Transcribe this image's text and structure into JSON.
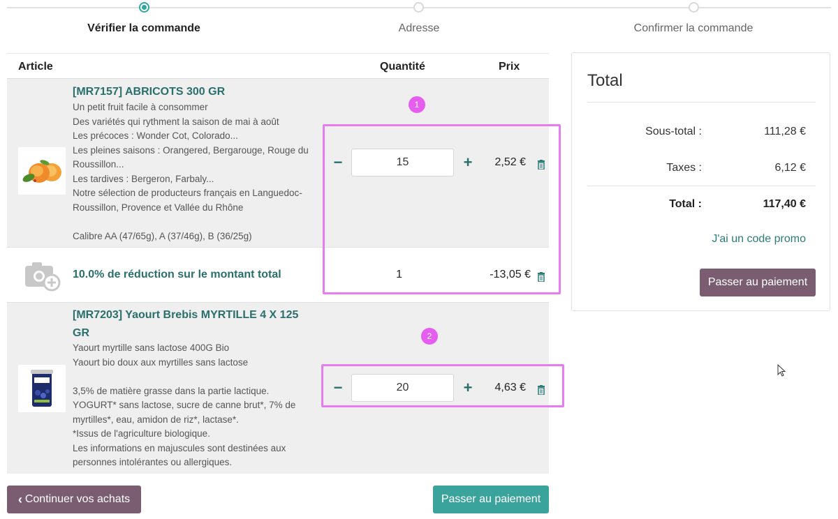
{
  "steps": [
    {
      "label": "Vérifier la commande",
      "active": true
    },
    {
      "label": "Adresse",
      "active": false
    },
    {
      "label": "Confirmer la commande",
      "active": false
    }
  ],
  "cart": {
    "headers": {
      "article": "Article",
      "quantity": "Quantité",
      "price": "Prix"
    },
    "items": [
      {
        "title": "[MR7157] ABRICOTS 300 GR",
        "description": "Un petit fruit facile à consommer\nDes variétés qui rythment la saison de mai à août\nLes précoces : Wonder Cot, Colorado...\nLes pleines saisons : Orangered, Bergarouge, Rouge du\nRoussillon...\nLes tardives : Bergeron, Farbaly...\nNotre sélection de producteurs français en Languedoc-\nRoussillon, Provence et Vallée du Rhône\n\nCalibre AA (47/65g), A (37/46g), B (36/25g)",
        "quantity": "15",
        "price": "2,52 €",
        "icon": "apricot-image"
      },
      {
        "title": "10.0% de réduction sur le montant total",
        "quantity": "1",
        "price": "-13,05 €",
        "icon": "camera-placeholder-icon"
      },
      {
        "title": "[MR7203] Yaourt Brebis MYRTILLE 4 X 125\nGR",
        "description": "Yaourt myrtille sans lactose 400G Bio\nYaourt bio doux aux myrtilles sans lactose\n\n3,5% de matière grasse dans la partie lactique.\nYOGURT* sans lactose, sucre de canne brut*, 7% de\nmyrtilles*, eau, amidon de riz*, lactase*.\n*Issus de l'agriculture biologique.\nLes informations en majuscules sont destinées aux\npersonnes intolérantes ou allergiques.",
        "quantity": "20",
        "price": "4,63 €",
        "icon": "yogurt-image"
      }
    ],
    "badges": [
      "1",
      "2"
    ]
  },
  "buttons": {
    "continue": "Continuer vos achats",
    "pay": "Passer au paiement"
  },
  "summary": {
    "title": "Total",
    "subtotal_label": "Sous-total :",
    "subtotal_value": "111,28 €",
    "taxes_label": "Taxes :",
    "taxes_value": "6,12 €",
    "total_label": "Total :",
    "total_value": "117,40 €",
    "promo": "J'ai un code promo",
    "pay": "Passer au paiement"
  },
  "colors": {
    "accent_teal": "#2a6f6c",
    "button_mauve": "#7b5d72",
    "button_teal": "#3aa39b",
    "highlight_pink": "#e57cf0"
  }
}
